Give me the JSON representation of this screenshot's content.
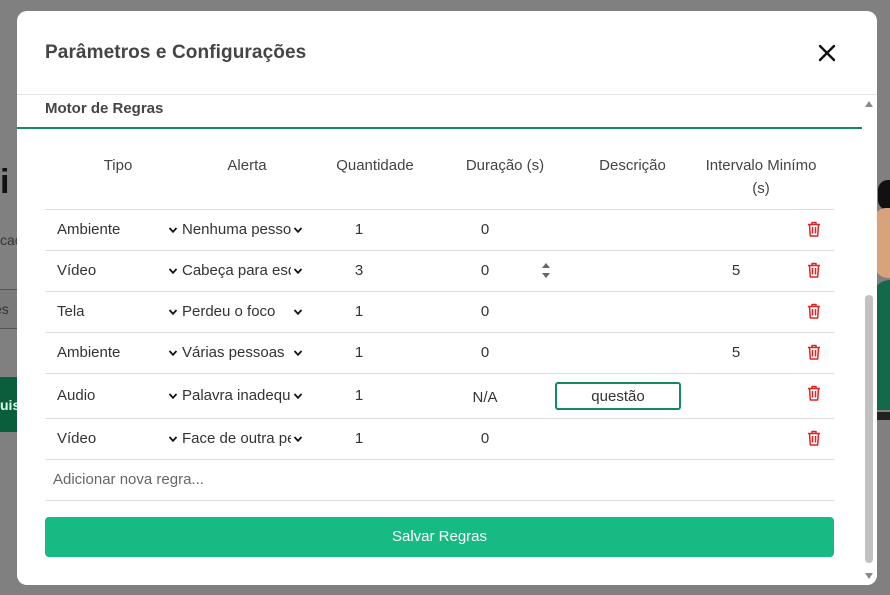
{
  "background": {
    "title_fragment": "i",
    "subtitle_fragment": "cac",
    "input_fragment": "es",
    "button_fragment": "uis"
  },
  "modal": {
    "title": "Parâmetros e Configurações",
    "section_title": "Motor de Regras",
    "columns": [
      "Tipo",
      "Alerta",
      "Quantidade",
      "Duração (s)",
      "Descrição",
      "Intervalo Minímo (s)"
    ],
    "rows": [
      {
        "tipo": "Ambiente",
        "alerta": "Nenhuma pessoa",
        "quantidade": "1",
        "duracao": "0",
        "descricao": "",
        "intervalo": ""
      },
      {
        "tipo": "Vídeo",
        "alerta": "Cabeça para esquerda",
        "quantidade": "3",
        "duracao": "0",
        "descricao": "",
        "intervalo": "5"
      },
      {
        "tipo": "Tela",
        "alerta": "Perdeu o foco",
        "quantidade": "1",
        "duracao": "0",
        "descricao": "",
        "intervalo": ""
      },
      {
        "tipo": "Ambiente",
        "alerta": "Várias pessoas",
        "quantidade": "1",
        "duracao": "0",
        "descricao": "",
        "intervalo": "5"
      },
      {
        "tipo": "Audio",
        "alerta": "Palavra inadequada",
        "quantidade": "1",
        "duracao": "N/A",
        "descricao": "questão",
        "intervalo": ""
      },
      {
        "tipo": "Vídeo",
        "alerta": "Face de outra pessoa",
        "quantidade": "1",
        "duracao": "0",
        "descricao": "",
        "intervalo": ""
      }
    ],
    "add_rule_placeholder": "Adicionar nova regra...",
    "save_label": "Salvar Regras"
  },
  "colors": {
    "accent": "#138a63",
    "save_button": "#16ba82",
    "delete_icon": "#e02424"
  },
  "icons": {
    "close": "close-icon",
    "dropdown": "chevron-down-icon",
    "delete": "trash-icon"
  }
}
